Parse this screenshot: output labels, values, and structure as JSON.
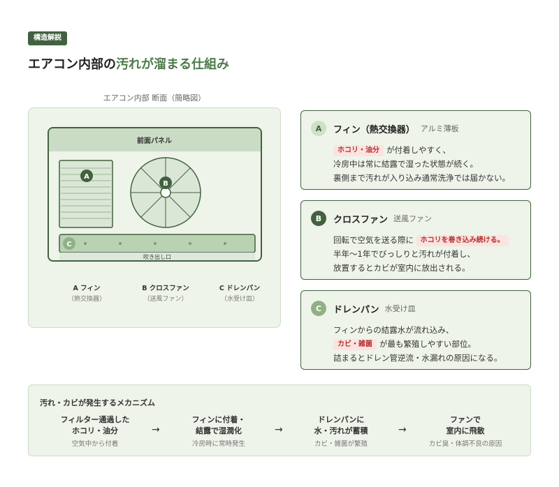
{
  "header": {
    "tag": "構造解説",
    "title_pre": "エアコン内部の",
    "title_hl": "汚れが溜まる仕組み"
  },
  "diagram": {
    "caption": "エアコン内部 断面（簡略図）",
    "front_panel": "前面パネル",
    "outlet": "吹き出し口",
    "markers": [
      "A",
      "B",
      "C"
    ],
    "labels": [
      {
        "name": "A フィン",
        "sub": "（熱交換器）"
      },
      {
        "name": "B クロスファン",
        "sub": "（送風ファン）"
      },
      {
        "name": "C ドレンパン",
        "sub": "（水受け皿）"
      }
    ]
  },
  "cards": [
    {
      "badge": "A",
      "title": "フィン（熱交換器）",
      "sub": "アルミ薄板",
      "pill": "ホコリ・油分",
      "line1_after": "が付着しやすく、",
      "line2": "冷房中は常に結露で湿った状態が続く。",
      "line3": "裏側まで汚れが入り込み通常洗浄では届かない。"
    },
    {
      "badge": "B",
      "title": "クロスファン",
      "sub": "送風ファン",
      "line1_before": "回転で空気を送る際に",
      "pill": "ホコリを巻き込み続ける。",
      "line2": "半年〜1年でびっしりと汚れが付着し、",
      "line3": "放置するとカビが室内に放出される。"
    },
    {
      "badge": "C",
      "title": "ドレンパン",
      "sub": "水受け皿",
      "line1": "フィンからの結露水が流れ込み、",
      "pill": "カビ・雑菌",
      "line2_after": "が最も繁殖しやすい部位。",
      "line3": "詰まるとドレン管逆流・水漏れの原因になる。"
    }
  ],
  "mechanism": {
    "title": "汚れ・カビが発生するメカニズム",
    "steps": [
      {
        "l1": "フィルター通過した",
        "l2": "ホコリ・油分",
        "sub": "空気中から付着"
      },
      {
        "l1": "フィンに付着・",
        "l2": "結露で湿潤化",
        "sub": "冷房時に常時発生"
      },
      {
        "l1": "ドレンパンに",
        "l2": "水・汚れが蓄積",
        "sub": "カビ・雑菌が繁殖"
      },
      {
        "l1": "ファンで",
        "l2": "室内に飛散",
        "sub": "カビ臭・体調不良の原因"
      }
    ],
    "arrow": "→"
  },
  "colors": {
    "dark_green": "#41613f",
    "mid_green": "#4e7b4b",
    "light_bg": "#eef4ea",
    "pill_bg": "#fbe3e1",
    "pill_text": "#b4302c"
  }
}
